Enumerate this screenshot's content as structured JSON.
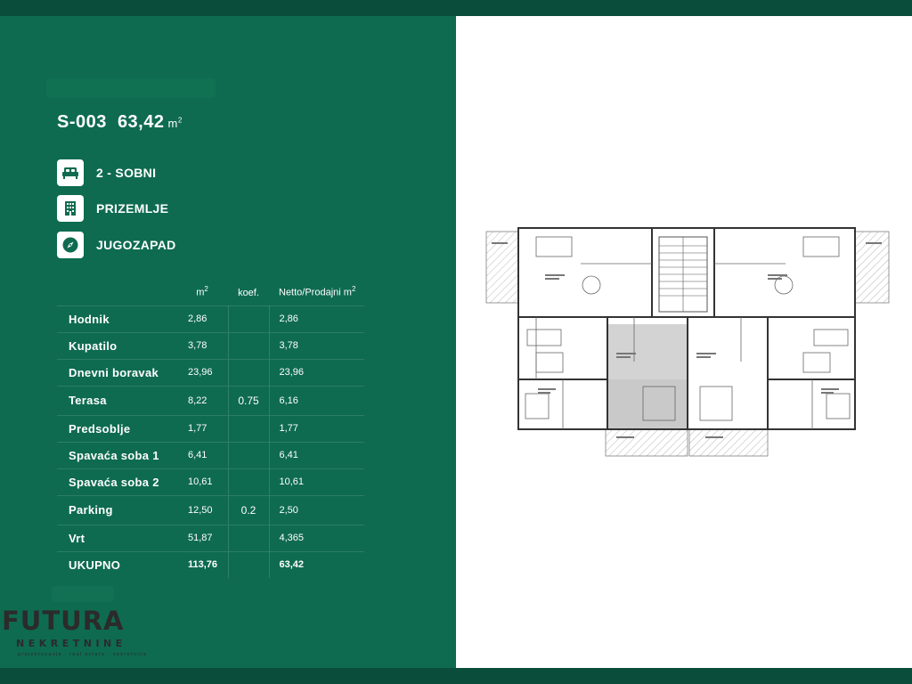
{
  "title": {
    "code": "S-003",
    "area": "63,42",
    "unit": "m",
    "unit_exp": "2"
  },
  "features": [
    {
      "icon": "bed-icon",
      "label": "2 - SOBNI"
    },
    {
      "icon": "building-icon",
      "label": "PRIZEMLJE"
    },
    {
      "icon": "compass-icon",
      "label": "JUGOZAPAD"
    }
  ],
  "table": {
    "headers": {
      "m2": "m",
      "m2_exp": "2",
      "koef": "koef.",
      "netto": "Netto/Prodajni m",
      "netto_exp": "2"
    },
    "rows": [
      {
        "name": "Hodnik",
        "m2": "2,86",
        "koef": "",
        "netto": "2,86"
      },
      {
        "name": "Kupatilo",
        "m2": "3,78",
        "koef": "",
        "netto": "3,78"
      },
      {
        "name": "Dnevni boravak",
        "m2": "23,96",
        "koef": "",
        "netto": "23,96"
      },
      {
        "name": "Terasa",
        "m2": "8,22",
        "koef": "0.75",
        "netto": "6,16"
      },
      {
        "name": "Predsoblje",
        "m2": "1,77",
        "koef": "",
        "netto": "1,77"
      },
      {
        "name": "Spavaća soba 1",
        "m2": "6,41",
        "koef": "",
        "netto": "6,41"
      },
      {
        "name": "Spavaća soba 2",
        "m2": "10,61",
        "koef": "",
        "netto": "10,61"
      },
      {
        "name": "Parking",
        "m2": "12,50",
        "koef": "0.2",
        "netto": "2,50"
      },
      {
        "name": "Vrt",
        "m2": "51,87",
        "koef": "",
        "netto": "4,365"
      },
      {
        "name": "UKUPNO",
        "m2": "113,76",
        "koef": "",
        "netto": "63,42"
      }
    ]
  },
  "logo": {
    "word": "FUTURA",
    "sub": "NEKRETNINE",
    "tag": "projektovanje · real estate · nekretnine"
  },
  "colors": {
    "panel": "#0e6b4f",
    "bar": "#0a4d3a",
    "highlight": "#c9c9c9"
  }
}
